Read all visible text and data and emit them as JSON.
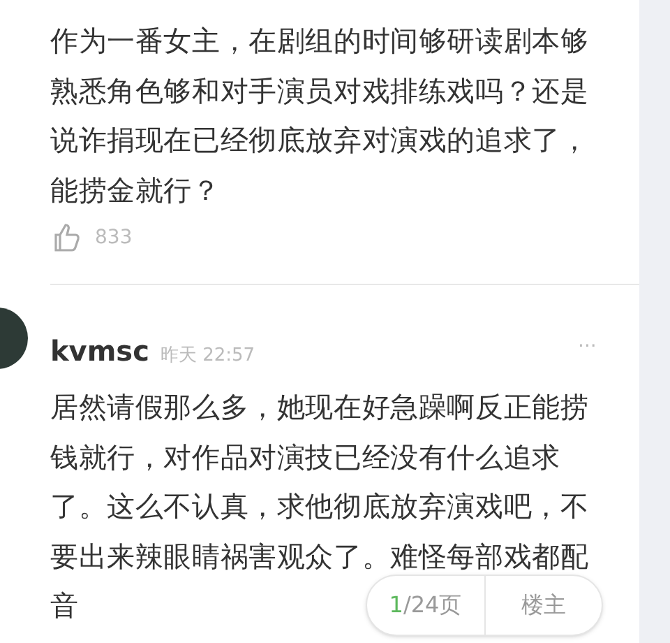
{
  "comments": [
    {
      "text": "作为一番女主，在剧组的时间够研读剧本够熟悉角色够和对手演员对戏排练戏吗？还是说诈捐现在已经彻底放弃对演戏的追求了，能捞金就行？",
      "likes": "833"
    },
    {
      "user": "kvmsc",
      "time": "昨天 22:57",
      "more": "···",
      "lines": [
        "居然请假那么多，她现在好急躁啊反正能捞",
        "钱就行，对作品对演技已经没有什么追求",
        "了。这么不认真，求他彻底放弃演戏吧，不",
        "要出来辣眼睛祸害观众了。难怪每部戏都配",
        "音"
      ]
    }
  ],
  "pager": {
    "current": "1",
    "total": "/24页",
    "author_button": "楼主"
  }
}
